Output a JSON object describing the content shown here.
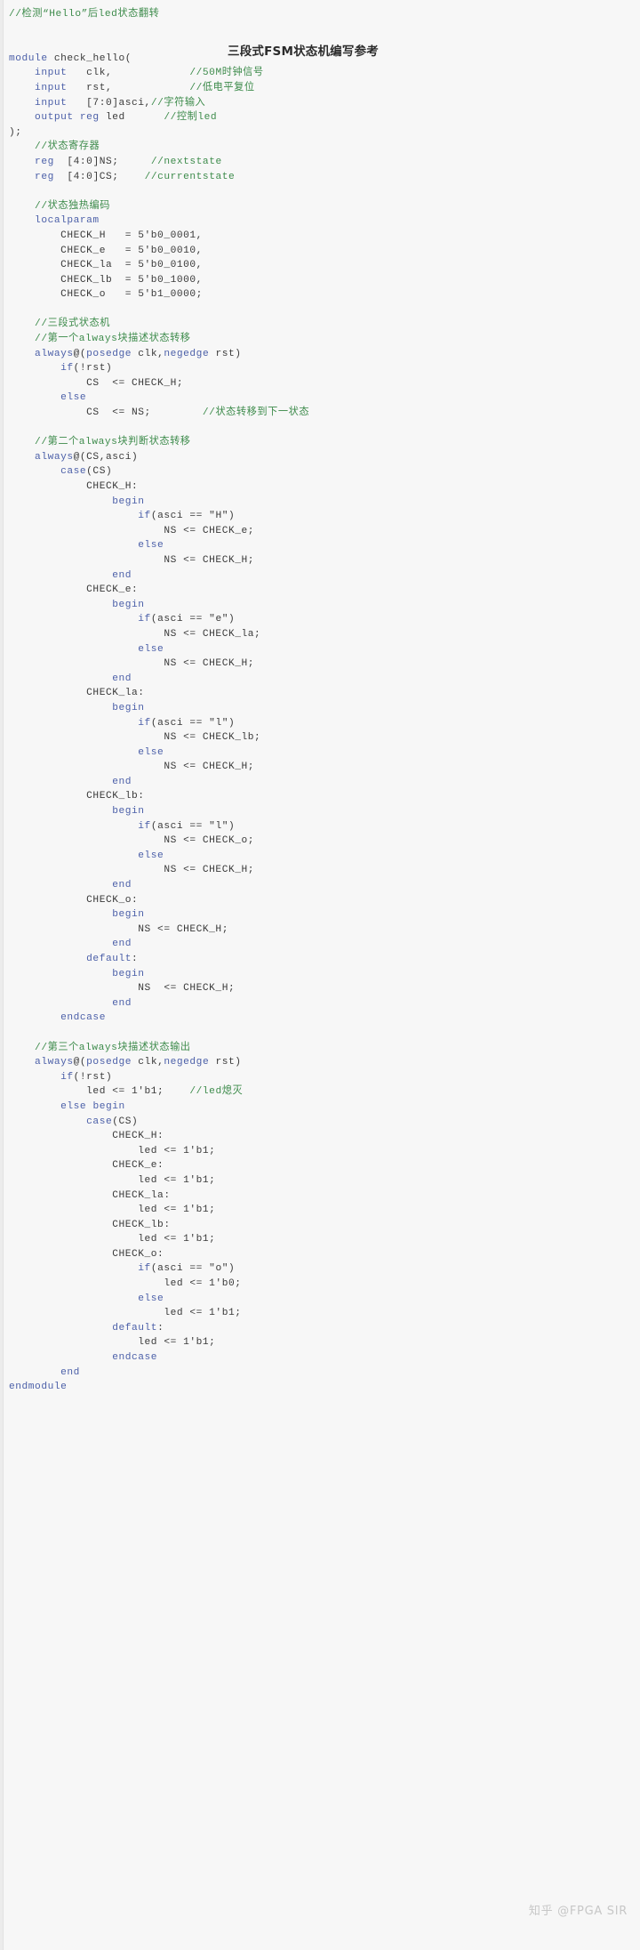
{
  "page": {
    "background_color": "#f7f7f7",
    "language": "verilog",
    "comment_color": "#3d8b4b",
    "keyword_color": "#4b5fa8",
    "text_color": "#2f2f2f"
  },
  "note_title": "三段式FSM状态机编写参考",
  "watermark": "知乎 @FPGA SIR",
  "code": {
    "lines": [
      {
        "indent": 0,
        "tokens": [
          {
            "t": "//检测“Hello”后led状态翻转",
            "c": "c"
          }
        ]
      },
      {
        "indent": 0,
        "tokens": []
      },
      {
        "indent": 0,
        "tokens": []
      },
      {
        "indent": 0,
        "tokens": [
          {
            "t": "module",
            "c": "k"
          },
          {
            "t": " check_hello(",
            "c": "p"
          }
        ]
      },
      {
        "indent": 1,
        "tokens": [
          {
            "t": "input",
            "c": "k"
          },
          {
            "t": "   clk,            ",
            "c": "p"
          },
          {
            "t": "//50M时钟信号",
            "c": "c"
          }
        ]
      },
      {
        "indent": 1,
        "tokens": [
          {
            "t": "input",
            "c": "k"
          },
          {
            "t": "   rst,            ",
            "c": "p"
          },
          {
            "t": "//低电平复位",
            "c": "c"
          }
        ]
      },
      {
        "indent": 1,
        "tokens": [
          {
            "t": "input",
            "c": "k"
          },
          {
            "t": "   [7:0]asci,",
            "c": "p"
          },
          {
            "t": "//字符输入",
            "c": "c"
          }
        ]
      },
      {
        "indent": 1,
        "tokens": [
          {
            "t": "output",
            "c": "k"
          },
          {
            "t": " ",
            "c": "p"
          },
          {
            "t": "reg",
            "c": "k"
          },
          {
            "t": " led      ",
            "c": "p"
          },
          {
            "t": "//控制led",
            "c": "c"
          }
        ]
      },
      {
        "indent": 0,
        "tokens": [
          {
            "t": ");",
            "c": "p"
          }
        ]
      },
      {
        "indent": 1,
        "tokens": [
          {
            "t": "//状态寄存器",
            "c": "c"
          }
        ]
      },
      {
        "indent": 1,
        "tokens": [
          {
            "t": "reg",
            "c": "k"
          },
          {
            "t": "  [4:0]NS;     ",
            "c": "p"
          },
          {
            "t": "//nextstate",
            "c": "c"
          }
        ]
      },
      {
        "indent": 1,
        "tokens": [
          {
            "t": "reg",
            "c": "k"
          },
          {
            "t": "  [4:0]CS;    ",
            "c": "p"
          },
          {
            "t": "//currentstate",
            "c": "c"
          }
        ]
      },
      {
        "indent": 0,
        "tokens": []
      },
      {
        "indent": 1,
        "tokens": [
          {
            "t": "//状态独热编码",
            "c": "c"
          }
        ]
      },
      {
        "indent": 1,
        "tokens": [
          {
            "t": "localparam",
            "c": "k"
          }
        ]
      },
      {
        "indent": 2,
        "tokens": [
          {
            "t": "CHECK_H   = 5'b0_0001,",
            "c": "p"
          }
        ]
      },
      {
        "indent": 2,
        "tokens": [
          {
            "t": "CHECK_e   = 5'b0_0010,",
            "c": "p"
          }
        ]
      },
      {
        "indent": 2,
        "tokens": [
          {
            "t": "CHECK_la  = 5'b0_0100,",
            "c": "p"
          }
        ]
      },
      {
        "indent": 2,
        "tokens": [
          {
            "t": "CHECK_lb  = 5'b0_1000,",
            "c": "p"
          }
        ]
      },
      {
        "indent": 2,
        "tokens": [
          {
            "t": "CHECK_o   = 5'b1_0000;",
            "c": "p"
          }
        ]
      },
      {
        "indent": 0,
        "tokens": []
      },
      {
        "indent": 1,
        "tokens": [
          {
            "t": "//三段式状态机",
            "c": "c"
          }
        ]
      },
      {
        "indent": 1,
        "tokens": [
          {
            "t": "//第一个always块描述状态转移",
            "c": "c"
          }
        ]
      },
      {
        "indent": 1,
        "tokens": [
          {
            "t": "always",
            "c": "k"
          },
          {
            "t": "@(",
            "c": "p"
          },
          {
            "t": "posedge",
            "c": "k"
          },
          {
            "t": " clk,",
            "c": "p"
          },
          {
            "t": "negedge",
            "c": "k"
          },
          {
            "t": " rst)",
            "c": "p"
          }
        ]
      },
      {
        "indent": 2,
        "tokens": [
          {
            "t": "if",
            "c": "k"
          },
          {
            "t": "(!rst)",
            "c": "p"
          }
        ]
      },
      {
        "indent": 3,
        "tokens": [
          {
            "t": "CS  <= CHECK_H;",
            "c": "p"
          }
        ]
      },
      {
        "indent": 2,
        "tokens": [
          {
            "t": "else",
            "c": "k"
          }
        ]
      },
      {
        "indent": 3,
        "tokens": [
          {
            "t": "CS  <= NS;        ",
            "c": "p"
          },
          {
            "t": "//状态转移到下一状态",
            "c": "c"
          }
        ]
      },
      {
        "indent": 0,
        "tokens": []
      },
      {
        "indent": 1,
        "tokens": [
          {
            "t": "//第二个always块判断状态转移",
            "c": "c"
          }
        ]
      },
      {
        "indent": 1,
        "tokens": [
          {
            "t": "always",
            "c": "k"
          },
          {
            "t": "@(CS,asci)",
            "c": "p"
          }
        ]
      },
      {
        "indent": 2,
        "tokens": [
          {
            "t": "case",
            "c": "k"
          },
          {
            "t": "(CS)",
            "c": "p"
          }
        ]
      },
      {
        "indent": 3,
        "tokens": [
          {
            "t": "CHECK_H:",
            "c": "p"
          }
        ]
      },
      {
        "indent": 4,
        "tokens": [
          {
            "t": "begin",
            "c": "k"
          }
        ]
      },
      {
        "indent": 5,
        "tokens": [
          {
            "t": "if",
            "c": "k"
          },
          {
            "t": "(asci == \"H\")",
            "c": "p"
          }
        ]
      },
      {
        "indent": 6,
        "tokens": [
          {
            "t": "NS <= CHECK_e;",
            "c": "p"
          }
        ]
      },
      {
        "indent": 5,
        "tokens": [
          {
            "t": "else",
            "c": "k"
          }
        ]
      },
      {
        "indent": 6,
        "tokens": [
          {
            "t": "NS <= CHECK_H;",
            "c": "p"
          }
        ]
      },
      {
        "indent": 4,
        "tokens": [
          {
            "t": "end",
            "c": "k"
          }
        ]
      },
      {
        "indent": 3,
        "tokens": [
          {
            "t": "CHECK_e:",
            "c": "p"
          }
        ]
      },
      {
        "indent": 4,
        "tokens": [
          {
            "t": "begin",
            "c": "k"
          }
        ]
      },
      {
        "indent": 5,
        "tokens": [
          {
            "t": "if",
            "c": "k"
          },
          {
            "t": "(asci == \"e\")",
            "c": "p"
          }
        ]
      },
      {
        "indent": 6,
        "tokens": [
          {
            "t": "NS <= CHECK_la;",
            "c": "p"
          }
        ]
      },
      {
        "indent": 5,
        "tokens": [
          {
            "t": "else",
            "c": "k"
          }
        ]
      },
      {
        "indent": 6,
        "tokens": [
          {
            "t": "NS <= CHECK_H;",
            "c": "p"
          }
        ]
      },
      {
        "indent": 4,
        "tokens": [
          {
            "t": "end",
            "c": "k"
          }
        ]
      },
      {
        "indent": 3,
        "tokens": [
          {
            "t": "CHECK_la:",
            "c": "p"
          }
        ]
      },
      {
        "indent": 4,
        "tokens": [
          {
            "t": "begin",
            "c": "k"
          }
        ]
      },
      {
        "indent": 5,
        "tokens": [
          {
            "t": "if",
            "c": "k"
          },
          {
            "t": "(asci == \"l\")",
            "c": "p"
          }
        ]
      },
      {
        "indent": 6,
        "tokens": [
          {
            "t": "NS <= CHECK_lb;",
            "c": "p"
          }
        ]
      },
      {
        "indent": 5,
        "tokens": [
          {
            "t": "else",
            "c": "k"
          }
        ]
      },
      {
        "indent": 6,
        "tokens": [
          {
            "t": "NS <= CHECK_H;",
            "c": "p"
          }
        ]
      },
      {
        "indent": 4,
        "tokens": [
          {
            "t": "end",
            "c": "k"
          }
        ]
      },
      {
        "indent": 3,
        "tokens": [
          {
            "t": "CHECK_lb:",
            "c": "p"
          }
        ]
      },
      {
        "indent": 4,
        "tokens": [
          {
            "t": "begin",
            "c": "k"
          }
        ]
      },
      {
        "indent": 5,
        "tokens": [
          {
            "t": "if",
            "c": "k"
          },
          {
            "t": "(asci == \"l\")",
            "c": "p"
          }
        ]
      },
      {
        "indent": 6,
        "tokens": [
          {
            "t": "NS <= CHECK_o;",
            "c": "p"
          }
        ]
      },
      {
        "indent": 5,
        "tokens": [
          {
            "t": "else",
            "c": "k"
          }
        ]
      },
      {
        "indent": 6,
        "tokens": [
          {
            "t": "NS <= CHECK_H;",
            "c": "p"
          }
        ]
      },
      {
        "indent": 4,
        "tokens": [
          {
            "t": "end",
            "c": "k"
          }
        ]
      },
      {
        "indent": 3,
        "tokens": [
          {
            "t": "CHECK_o:",
            "c": "p"
          }
        ]
      },
      {
        "indent": 4,
        "tokens": [
          {
            "t": "begin",
            "c": "k"
          }
        ]
      },
      {
        "indent": 5,
        "tokens": [
          {
            "t": "NS <= CHECK_H;",
            "c": "p"
          }
        ]
      },
      {
        "indent": 4,
        "tokens": [
          {
            "t": "end",
            "c": "k"
          }
        ]
      },
      {
        "indent": 3,
        "tokens": [
          {
            "t": "default",
            "c": "k"
          },
          {
            "t": ":",
            "c": "p"
          }
        ]
      },
      {
        "indent": 4,
        "tokens": [
          {
            "t": "begin",
            "c": "k"
          }
        ]
      },
      {
        "indent": 5,
        "tokens": [
          {
            "t": "NS  <= CHECK_H;",
            "c": "p"
          }
        ]
      },
      {
        "indent": 4,
        "tokens": [
          {
            "t": "end",
            "c": "k"
          }
        ]
      },
      {
        "indent": 2,
        "tokens": [
          {
            "t": "endcase",
            "c": "k"
          }
        ]
      },
      {
        "indent": 0,
        "tokens": []
      },
      {
        "indent": 1,
        "tokens": [
          {
            "t": "//第三个always块描述状态输出",
            "c": "c"
          }
        ]
      },
      {
        "indent": 1,
        "tokens": [
          {
            "t": "always",
            "c": "k"
          },
          {
            "t": "@(",
            "c": "p"
          },
          {
            "t": "posedge",
            "c": "k"
          },
          {
            "t": " clk,",
            "c": "p"
          },
          {
            "t": "negedge",
            "c": "k"
          },
          {
            "t": " rst)",
            "c": "p"
          }
        ]
      },
      {
        "indent": 2,
        "tokens": [
          {
            "t": "if",
            "c": "k"
          },
          {
            "t": "(!rst)",
            "c": "p"
          }
        ]
      },
      {
        "indent": 3,
        "tokens": [
          {
            "t": "led <= 1'b1;    ",
            "c": "p"
          },
          {
            "t": "//led熄灭",
            "c": "c"
          }
        ]
      },
      {
        "indent": 2,
        "tokens": [
          {
            "t": "else",
            "c": "k"
          },
          {
            "t": " ",
            "c": "p"
          },
          {
            "t": "begin",
            "c": "k"
          }
        ]
      },
      {
        "indent": 3,
        "tokens": [
          {
            "t": "case",
            "c": "k"
          },
          {
            "t": "(CS)",
            "c": "p"
          }
        ]
      },
      {
        "indent": 4,
        "tokens": [
          {
            "t": "CHECK_H:",
            "c": "p"
          }
        ]
      },
      {
        "indent": 5,
        "tokens": [
          {
            "t": "led <= 1'b1;",
            "c": "p"
          }
        ]
      },
      {
        "indent": 4,
        "tokens": [
          {
            "t": "CHECK_e:",
            "c": "p"
          }
        ]
      },
      {
        "indent": 5,
        "tokens": [
          {
            "t": "led <= 1'b1;",
            "c": "p"
          }
        ]
      },
      {
        "indent": 4,
        "tokens": [
          {
            "t": "CHECK_la:",
            "c": "p"
          }
        ]
      },
      {
        "indent": 5,
        "tokens": [
          {
            "t": "led <= 1'b1;",
            "c": "p"
          }
        ]
      },
      {
        "indent": 4,
        "tokens": [
          {
            "t": "CHECK_lb:",
            "c": "p"
          }
        ]
      },
      {
        "indent": 5,
        "tokens": [
          {
            "t": "led <= 1'b1;",
            "c": "p"
          }
        ]
      },
      {
        "indent": 4,
        "tokens": [
          {
            "t": "CHECK_o:",
            "c": "p"
          }
        ]
      },
      {
        "indent": 5,
        "tokens": [
          {
            "t": "if",
            "c": "k"
          },
          {
            "t": "(asci == \"o\")",
            "c": "p"
          }
        ]
      },
      {
        "indent": 6,
        "tokens": [
          {
            "t": "led <= 1'b0;",
            "c": "p"
          }
        ]
      },
      {
        "indent": 5,
        "tokens": [
          {
            "t": "else",
            "c": "k"
          }
        ]
      },
      {
        "indent": 6,
        "tokens": [
          {
            "t": "led <= 1'b1;",
            "c": "p"
          }
        ]
      },
      {
        "indent": 4,
        "tokens": [
          {
            "t": "default",
            "c": "k"
          },
          {
            "t": ":",
            "c": "p"
          }
        ]
      },
      {
        "indent": 5,
        "tokens": [
          {
            "t": "led <= 1'b1;",
            "c": "p"
          }
        ]
      },
      {
        "indent": 4,
        "tokens": [
          {
            "t": "endcase",
            "c": "k"
          }
        ]
      },
      {
        "indent": 2,
        "tokens": [
          {
            "t": "end",
            "c": "k"
          }
        ]
      },
      {
        "indent": 0,
        "tokens": [
          {
            "t": "endmodule",
            "c": "k"
          }
        ]
      }
    ]
  }
}
